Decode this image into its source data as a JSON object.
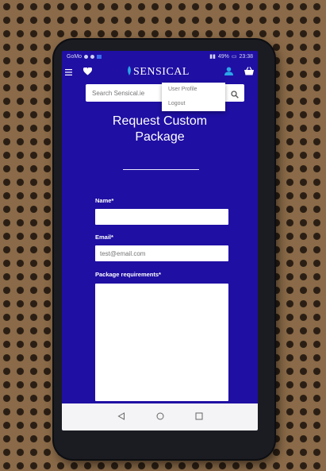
{
  "status_bar": {
    "carrier": "GoMo",
    "battery": "49%",
    "time": "23:38"
  },
  "header": {
    "brand": "SENSICAL",
    "icons": [
      "menu-icon",
      "heart-icon",
      "user-icon",
      "basket-icon"
    ],
    "accent_color": "#2aa6e8"
  },
  "search": {
    "placeholder": "Search Sensical.ie"
  },
  "user_menu": {
    "items": [
      {
        "label": "User Profile"
      },
      {
        "label": "Logout"
      }
    ]
  },
  "form": {
    "title_line1": "Request Custom",
    "title_line2": "Package",
    "name_label": "Name*",
    "name_value": "",
    "email_label": "Email*",
    "email_placeholder": "test@email.com",
    "requirements_label": "Package requirements*",
    "requirements_value": ""
  },
  "colors": {
    "page_background": "#1f0fa3",
    "field_background": "#ffffff"
  }
}
